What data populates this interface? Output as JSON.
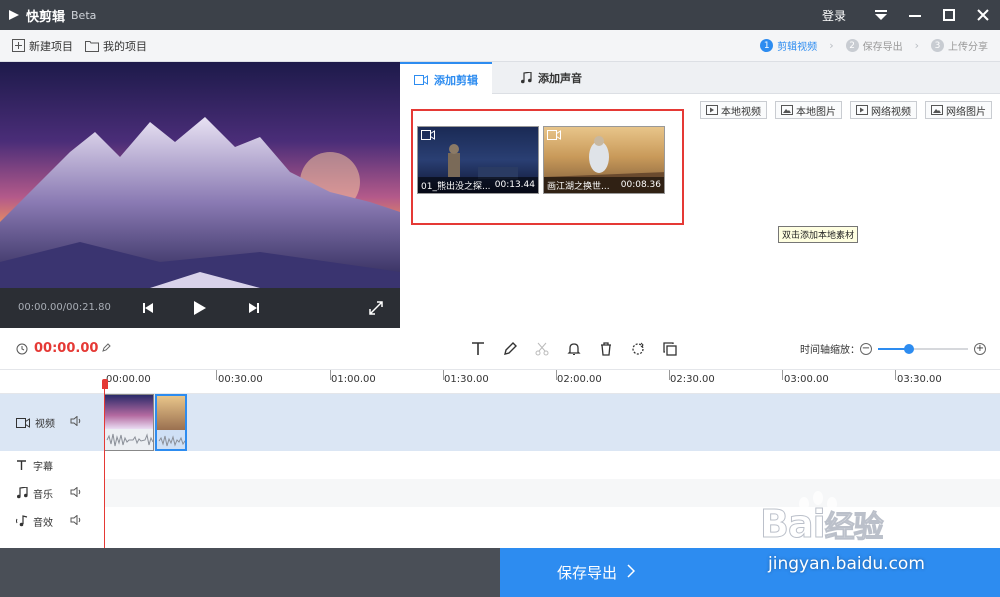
{
  "titlebar": {
    "app_name": "快剪辑",
    "beta": "Beta",
    "login": "登录"
  },
  "toolbar": {
    "new_project": "新建项目",
    "my_projects": "我的项目",
    "steps": [
      {
        "num": "1",
        "label": "剪辑视频",
        "active": true
      },
      {
        "num": "2",
        "label": "保存导出",
        "active": false
      },
      {
        "num": "3",
        "label": "上传分享",
        "active": false
      }
    ]
  },
  "preview": {
    "time": "00:00.00/00:21.80"
  },
  "right_panel": {
    "tabs": [
      {
        "label": "添加剪辑",
        "active": true
      },
      {
        "label": "添加声音",
        "active": false
      }
    ],
    "source_buttons": [
      "本地视频",
      "本地图片",
      "网络视频",
      "网络图片"
    ],
    "clips": [
      {
        "name": "01_熊出没之探...",
        "duration": "00:13.44"
      },
      {
        "name": "画江湖之换世...",
        "duration": "00:08.36"
      }
    ],
    "tooltip": "双击添加本地素材"
  },
  "timeline": {
    "current_time": "00:00.00",
    "zoom_label": "时间轴缩放：",
    "zoom_level": 0.35,
    "ruler_ticks": [
      "00:00.00",
      "00:30.00",
      "01:00.00",
      "01:30.00",
      "02:00.00",
      "02:30.00",
      "03:00.00",
      "03:30.00"
    ],
    "tracks": {
      "video": "视频",
      "subtitle": "字幕",
      "music": "音乐",
      "sfx": "音效"
    }
  },
  "footer": {
    "save_export": "保存导出"
  },
  "watermark": {
    "brand": "Bai",
    "cn": "经验",
    "url": "jingyan.baidu.com"
  }
}
